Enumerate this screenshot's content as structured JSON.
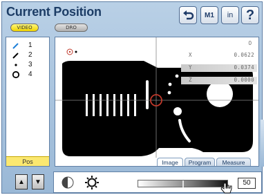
{
  "header": {
    "title": "Current Position"
  },
  "mode_pills": {
    "video": "VIDEO",
    "dro": "DRO"
  },
  "toolbar": {
    "undo_icon": "undo-icon",
    "m1_label": "M1",
    "units_label": "in",
    "help_label": "?"
  },
  "sidebar": {
    "features": [
      {
        "number": "1",
        "icon": "line-icon",
        "color": "#1e7fd8"
      },
      {
        "number": "2",
        "icon": "line-icon",
        "color": "#000000"
      },
      {
        "number": "3",
        "icon": "point-icon",
        "color": "#000000"
      },
      {
        "number": "4",
        "icon": "circle-icon",
        "color": "#000000"
      }
    ],
    "position_label": "Pos"
  },
  "dro": {
    "top_value": "0",
    "rows": [
      {
        "axis": "X",
        "value": "0.0622",
        "shaded": false
      },
      {
        "axis": "Y",
        "value": "0.0374",
        "shaded": true
      },
      {
        "axis": "Z",
        "value": "0.0000",
        "shaded": true
      }
    ]
  },
  "tabs": {
    "image": "Image",
    "program": "Program",
    "measure": "Measure"
  },
  "bottom": {
    "brightness_value": "50"
  },
  "colors": {
    "accent": "#1d3d66",
    "crosshair": "#c0392b",
    "pill_active": "#f0d400"
  }
}
